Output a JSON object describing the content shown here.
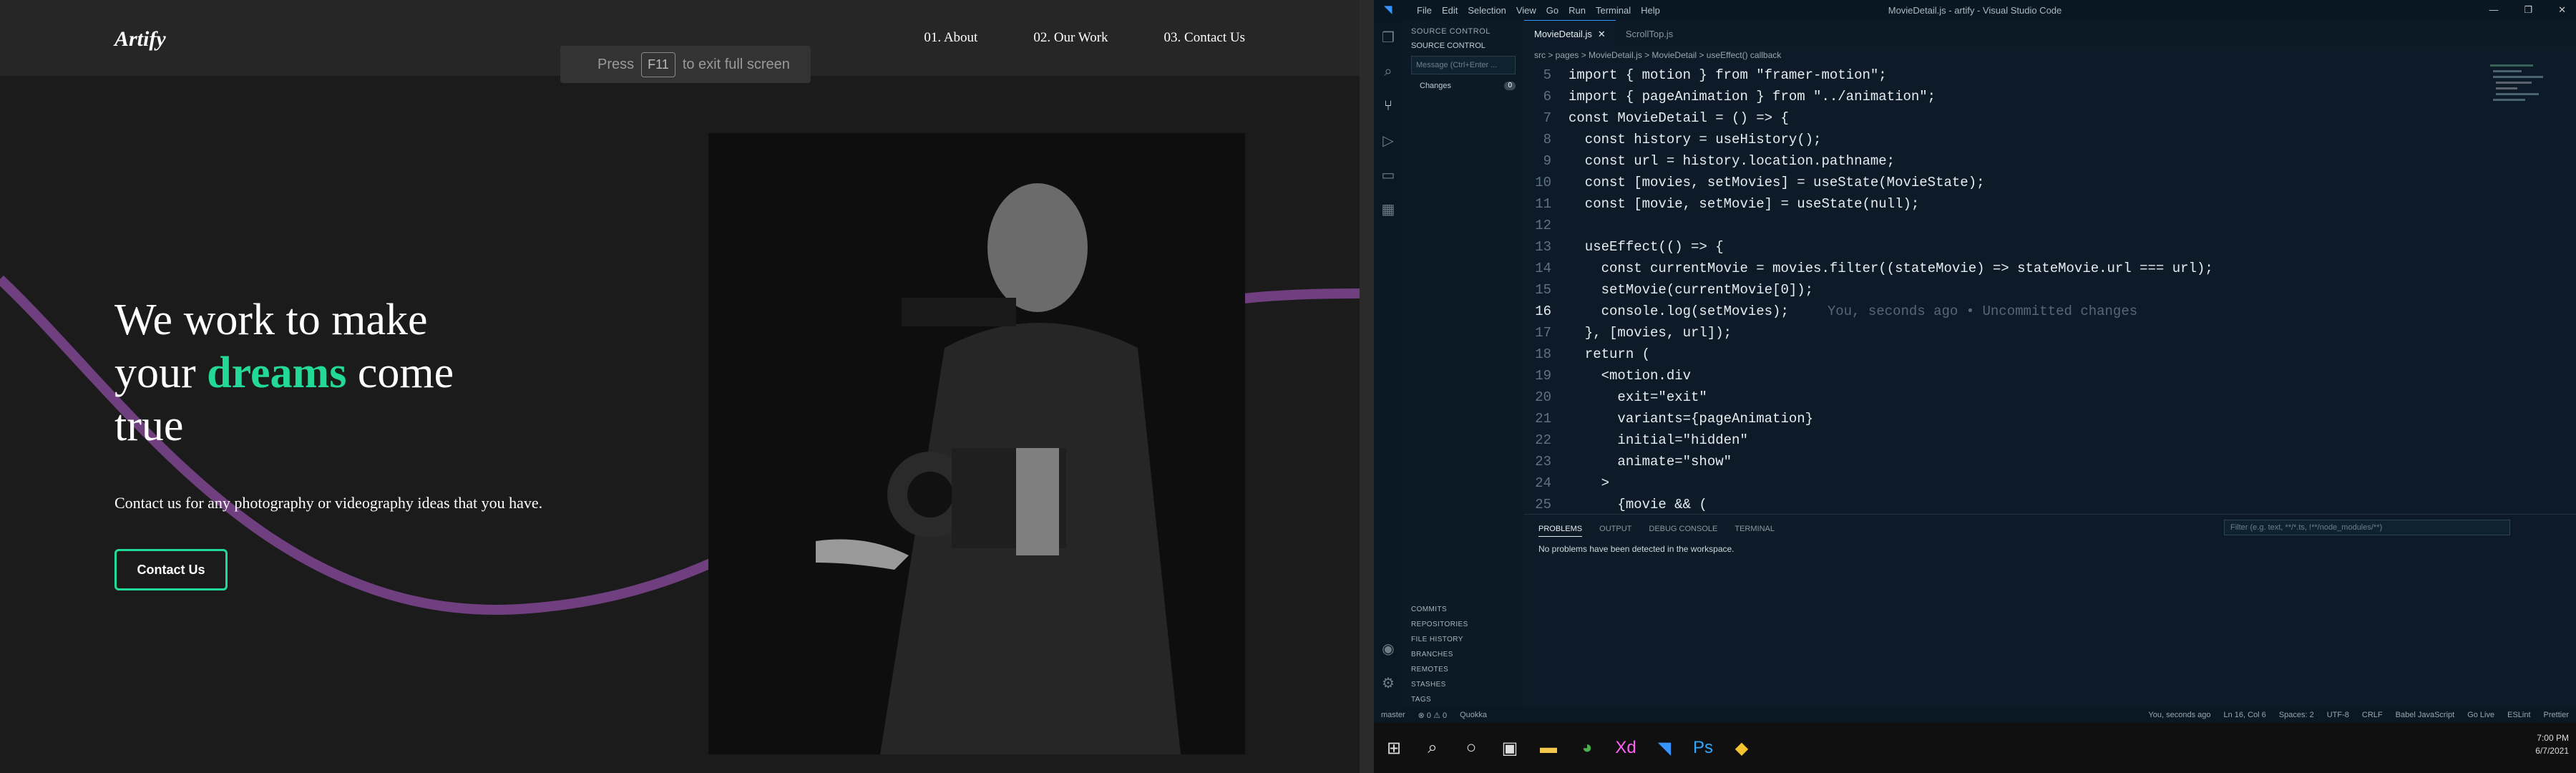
{
  "website": {
    "logo": "Artify",
    "nav": [
      "01. About",
      "02. Our Work",
      "03. Contact Us"
    ],
    "fullscreen_hint": {
      "prefix": "Press",
      "key": "F11",
      "suffix": "to exit full screen"
    },
    "hero": {
      "line1": "We work to make",
      "line2_pre": "your",
      "line2_accent": "dreams",
      "line2_post": "come",
      "line3": "true",
      "subtitle": "Contact us for any photography or videography ideas that you have.",
      "cta": "Contact Us"
    },
    "colors": {
      "accent": "#23d997",
      "curve": "#6f3f7f",
      "bg": "#1b1b1b"
    }
  },
  "vscode": {
    "menu": [
      "File",
      "Edit",
      "Selection",
      "View",
      "Go",
      "Run",
      "Terminal",
      "Help"
    ],
    "window_title": "MovieDetail.js - artify - Visual Studio Code",
    "sidebar": {
      "title": "SOURCE CONTROL",
      "section": "SOURCE CONTROL",
      "message_placeholder": "Message (Ctrl+Enter ...",
      "changes_label": "Changes",
      "changes_count": "0",
      "bottom": [
        "COMMITS",
        "REPOSITORIES",
        "FILE HISTORY",
        "BRANCHES",
        "REMOTES",
        "STASHES",
        "TAGS"
      ]
    },
    "tabs": [
      {
        "label": "MovieDetail.js",
        "active": true
      },
      {
        "label": "ScrollTop.js",
        "active": false
      }
    ],
    "breadcrumbs": "src > pages > MovieDetail.js > MovieDetail > useEffect() callback",
    "code": [
      {
        "n": "5",
        "text": "import { motion } from \"framer-motion\";"
      },
      {
        "n": "6",
        "text": "import { pageAnimation } from \"../animation\";"
      },
      {
        "n": "7",
        "text": "const MovieDetail = () => {"
      },
      {
        "n": "8",
        "text": "  const history = useHistory();"
      },
      {
        "n": "9",
        "text": "  const url = history.location.pathname;"
      },
      {
        "n": "10",
        "text": "  const [movies, setMovies] = useState(MovieState);"
      },
      {
        "n": "11",
        "text": "  const [movie, setMovie] = useState(null);"
      },
      {
        "n": "12",
        "text": ""
      },
      {
        "n": "13",
        "text": "  useEffect(() => {"
      },
      {
        "n": "14",
        "text": "    const currentMovie = movies.filter((stateMovie) => stateMovie.url === url);"
      },
      {
        "n": "15",
        "text": "    setMovie(currentMovie[0]);"
      },
      {
        "n": "16",
        "text": "    console.log(setMovies);"
      },
      {
        "n": "17",
        "text": "  }, [movies, url]);"
      },
      {
        "n": "18",
        "text": "  return ("
      },
      {
        "n": "19",
        "text": "    <motion.div"
      },
      {
        "n": "20",
        "text": "      exit=\"exit\""
      },
      {
        "n": "21",
        "text": "      variants={pageAnimation}"
      },
      {
        "n": "22",
        "text": "      initial=\"hidden\""
      },
      {
        "n": "23",
        "text": "      animate=\"show\""
      },
      {
        "n": "24",
        "text": "    >"
      },
      {
        "n": "25",
        "text": "      {movie && ("
      }
    ],
    "current_line": "16",
    "blame": "You, seconds ago • Uncommitted changes",
    "panel": {
      "tabs": [
        "PROBLEMS",
        "OUTPUT",
        "DEBUG CONSOLE",
        "TERMINAL"
      ],
      "filter_placeholder": "Filter (e.g. text, **/*.ts, !**/node_modules/**)",
      "message": "No problems have been detected in the workspace."
    },
    "status": {
      "left": [
        "master",
        "⊗ 0 ⚠ 0",
        "Quokka"
      ],
      "right": [
        "You, seconds ago",
        "Ln 16, Col 6",
        "Spaces: 2",
        "UTF-8",
        "CRLF",
        "Babel JavaScript",
        "Go Live",
        "ESLint",
        "Prettier"
      ]
    },
    "clock": {
      "time": "7:00 PM",
      "date": "6/7/2021"
    }
  }
}
